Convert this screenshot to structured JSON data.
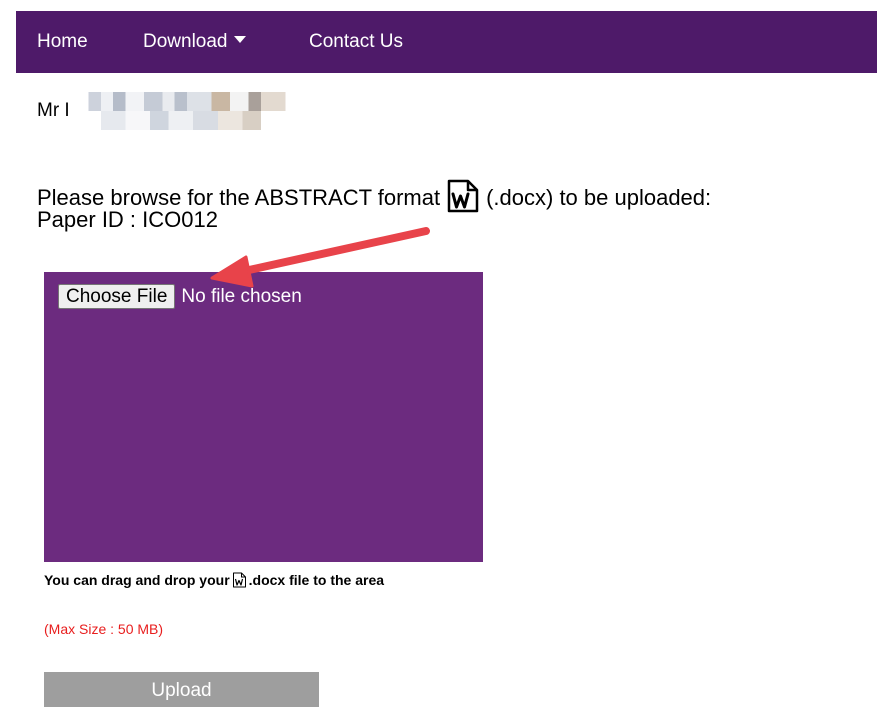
{
  "nav": {
    "items": [
      {
        "label": "Home"
      },
      {
        "label": "Download"
      },
      {
        "label": "Contact Us"
      }
    ]
  },
  "user": {
    "salutation": "Mr I"
  },
  "upload_form": {
    "prompt_before": "Please browse for the ABSTRACT format",
    "prompt_after": "(.docx) to be uploaded:",
    "paper_id": "Paper ID : ICO012",
    "choose_file_label": "Choose File",
    "file_status": "No file chosen",
    "drag_hint_before": "You can drag and drop your",
    "drag_hint_after": ".docx file to the area",
    "max_size": "(Max Size : 50 MB)",
    "upload_label": "Upload"
  },
  "colors": {
    "navbar": "#4e1a69",
    "drop_zone": "#6c2b7f",
    "max_size_text": "#e81e1e",
    "upload_button": "#9e9e9e",
    "annotation_arrow": "#e8434a"
  },
  "icons": {
    "word_document": "word-doc-icon",
    "dropdown": "caret-down-icon",
    "annotation": "red-arrow-annotation"
  }
}
